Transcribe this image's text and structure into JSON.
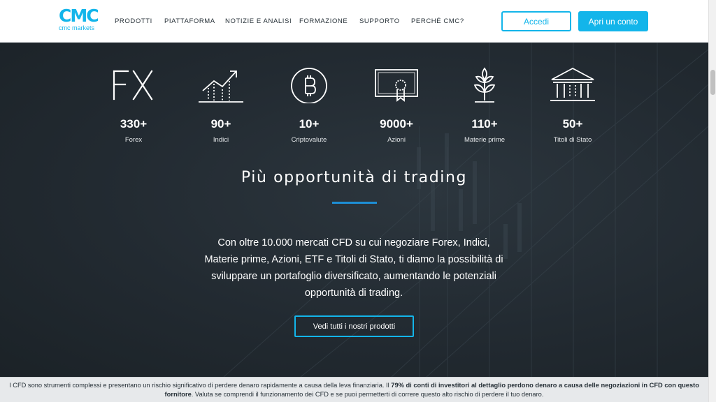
{
  "header": {
    "logo_mark": "CMC",
    "logo_sub": "cmc markets",
    "nav": [
      {
        "key": "prodotti",
        "label": "PRODOTTI"
      },
      {
        "key": "piattaforma",
        "label": "PIATTAFORMA"
      },
      {
        "key": "notizie",
        "label": "NOTIZIE E ANALISI"
      },
      {
        "key": "formazione",
        "label": "FORMAZIONE"
      },
      {
        "key": "supporto",
        "label": "SUPPORTO"
      },
      {
        "key": "perche",
        "label": "PERCHÉ CMC?"
      }
    ],
    "login_label": "Accedi",
    "open_account_label": "Apri un conto"
  },
  "markets": [
    {
      "icon": "fx-icon",
      "count": "330+",
      "label": "Forex"
    },
    {
      "icon": "rising-chart-icon",
      "count": "90+",
      "label": "Indici"
    },
    {
      "icon": "bitcoin-icon",
      "count": "10+",
      "label": "Criptovalute"
    },
    {
      "icon": "certificate-icon",
      "count": "9000+",
      "label": "Azioni"
    },
    {
      "icon": "plant-icon",
      "count": "110+",
      "label": "Materie prime"
    },
    {
      "icon": "government-building-icon",
      "count": "50+",
      "label": "Titoli di Stato"
    }
  ],
  "hero": {
    "title": "Più opportunità di trading",
    "text": "Con oltre 10.000 mercati CFD su cui negoziare Forex, Indici, Materie prime, Azioni, ETF e Titoli di Stato, ti diamo la possibilità di sviluppare un portafoglio diversificato, aumentando le potenziali opportunità di trading.",
    "cta_label": "Vedi tutti i nostri prodotti"
  },
  "risk": {
    "part1": "I CFD sono strumenti complessi e presentano un rischio significativo di perdere denaro rapidamente a causa della leva finanziaria. Il ",
    "bold": "79% di conti di investitori al dettaglio perdono denaro a causa delle negoziazioni in CFD con questo fornitore",
    "part2": ". Valuta se comprendi il funzionamento dei CFD e se puoi permetterti di correre questo alto rischio di perdere il tuo denaro."
  },
  "colors": {
    "accent": "#13b5ea",
    "hero_bg": "#222a31",
    "rule": "#1d8fd6",
    "risk_bg": "#e7e9eb"
  }
}
